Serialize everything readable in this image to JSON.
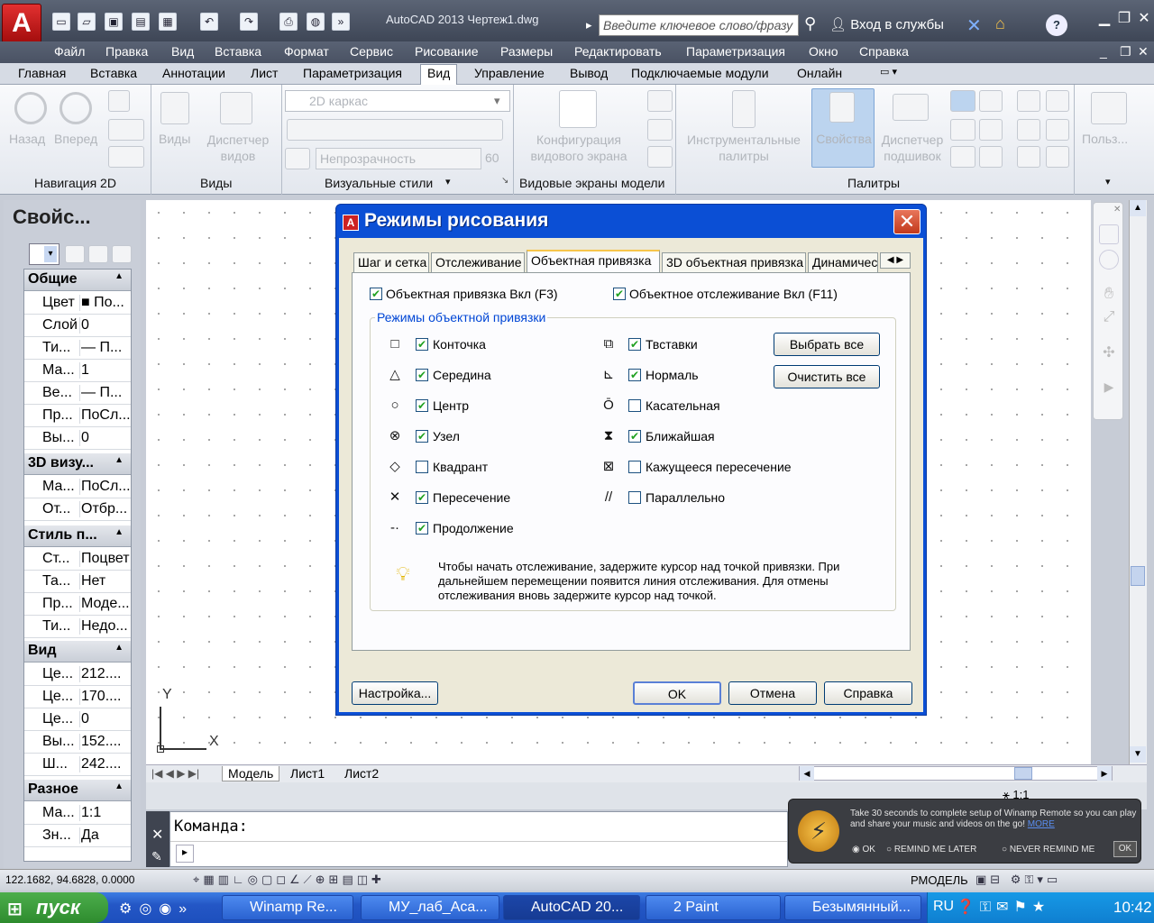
{
  "titlebar": {
    "app_icon": "A",
    "title": "AutoCAD 2013    Чертеж1.dwg",
    "search_placeholder": "Введите ключевое слово/фразу",
    "signin": "Вход в службы"
  },
  "menubar": [
    "Файл",
    "Правка",
    "Вид",
    "Вставка",
    "Формат",
    "Сервис",
    "Рисование",
    "Размеры",
    "Редактировать",
    "Параметризация",
    "Окно",
    "Справка"
  ],
  "ribbon_tabs": [
    "Главная",
    "Вставка",
    "Аннотации",
    "Лист",
    "Параметризация",
    "Вид",
    "Управление",
    "Вывод",
    "Подключаемые модули",
    "Онлайн"
  ],
  "ribbon": {
    "nav_back": "Назад",
    "nav_forward": "Вперед",
    "views": "Виды",
    "view_manager": "Диспетчер видов",
    "visual_style": "2D каркас",
    "opacity_label": "Непрозрачность",
    "opacity_value": "60",
    "viewport_config": "Конфигурация видового экрана",
    "tool_palettes": "Инструментальные палитры",
    "properties": "Свойства",
    "sheet_manager": "Диспетчер подшивок",
    "user": "Польз...",
    "panel_nav2d": "Навигация 2D",
    "panel_views": "Виды",
    "panel_visual_styles": "Визуальные стили",
    "panel_viewports": "Видовые экраны модели",
    "panel_palettes": "Палитры"
  },
  "props": {
    "title": "Свойс...",
    "sections": {
      "general": "Общие",
      "visual3d": "3D визу...",
      "plotstyle": "Стиль п...",
      "view": "Вид",
      "misc": "Разное"
    },
    "general_rows": [
      [
        "Цвет",
        "■ По..."
      ],
      [
        "Слой",
        "0"
      ],
      [
        "Ти...",
        "— П..."
      ],
      [
        "Ма...",
        "1"
      ],
      [
        "Ве...",
        "— П..."
      ],
      [
        "Пр...",
        "ПоСл..."
      ],
      [
        "Вы...",
        "0"
      ]
    ],
    "visual_rows": [
      [
        "Ма...",
        "ПоСл..."
      ],
      [
        "От...",
        "Отбр..."
      ]
    ],
    "plot_rows": [
      [
        "Ст...",
        "Поцвет"
      ],
      [
        "Та...",
        "Нет"
      ],
      [
        "Пр...",
        "Моде..."
      ],
      [
        "Ти...",
        "Недо..."
      ]
    ],
    "view_rows": [
      [
        "Це...",
        "212...."
      ],
      [
        "Це...",
        "170...."
      ],
      [
        "Це...",
        "0"
      ],
      [
        "Вы...",
        "152...."
      ],
      [
        "Ш...",
        "242...."
      ]
    ],
    "misc_rows": [
      [
        "Ма...",
        "1:1"
      ],
      [
        "Зн...",
        "Да"
      ]
    ]
  },
  "axes": {
    "x": "X",
    "y": "Y"
  },
  "layout_tabs": [
    "Модель",
    "Лист1",
    "Лист2"
  ],
  "command": {
    "prompt": "Команда:"
  },
  "status": {
    "coords": "122.1682, 94.6828, 0.0000",
    "model": "РМОДЕЛЬ",
    "scale": "1:1"
  },
  "dialog": {
    "title": "Режимы рисования",
    "tabs": [
      "Шаг и сетка",
      "Отслеживание",
      "Объектная привязка",
      "3D объектная привязка",
      "Динамичес"
    ],
    "osnap_on": "Объектная привязка Вкл (F3)",
    "otrack_on": "Объектное отслеживание Вкл (F11)",
    "group_title": "Режимы объектной привязки",
    "left_modes": [
      {
        "label": "Конточка",
        "checked": true,
        "symbol": "□"
      },
      {
        "label": "Середина",
        "checked": true,
        "symbol": "△"
      },
      {
        "label": "Центр",
        "checked": true,
        "symbol": "○"
      },
      {
        "label": "Узел",
        "checked": true,
        "symbol": "⊗"
      },
      {
        "label": "Квадрант",
        "checked": false,
        "symbol": "◇"
      },
      {
        "label": "Пересечение",
        "checked": true,
        "symbol": "✕"
      },
      {
        "label": "Продолжение",
        "checked": true,
        "symbol": "-·"
      }
    ],
    "right_modes": [
      {
        "label": "Твставки",
        "checked": true,
        "symbol": "⧉"
      },
      {
        "label": "Нормаль",
        "checked": true,
        "symbol": "⊾"
      },
      {
        "label": "Касательная",
        "checked": false,
        "symbol": "Ō"
      },
      {
        "label": "Ближайшая",
        "checked": true,
        "symbol": "⧗"
      },
      {
        "label": "Кажущееся пересечение",
        "checked": false,
        "symbol": "⊠"
      },
      {
        "label": "Параллельно",
        "checked": false,
        "symbol": "//"
      }
    ],
    "select_all": "Выбрать все",
    "clear_all": "Очистить все",
    "hint": "Чтобы начать отслеживание, задержите курсор над точкой привязки. При дальнейшем перемещении появится линия отслеживания. Для отмены отслеживания вновь задержите курсор над точкой.",
    "settings_btn": "Настройка...",
    "ok_btn": "OK",
    "cancel_btn": "Отмена",
    "help_btn": "Справка"
  },
  "winamp": {
    "message": "Take 30 seconds to complete setup of Winamp Remote so you can play and share your music and videos on the go!",
    "more": "MORE",
    "opt_ok": "OK",
    "opt_later": "REMIND ME LATER",
    "opt_never": "NEVER REMIND ME",
    "ok_btn": "OK"
  },
  "taskbar": {
    "start": "пуск",
    "items": [
      "Winamp Re...",
      "МУ_лаб_Аса...",
      "AutoCAD 20...",
      "2 Paint",
      "Безымянный..."
    ],
    "lang": "RU",
    "clock": "10:42"
  }
}
